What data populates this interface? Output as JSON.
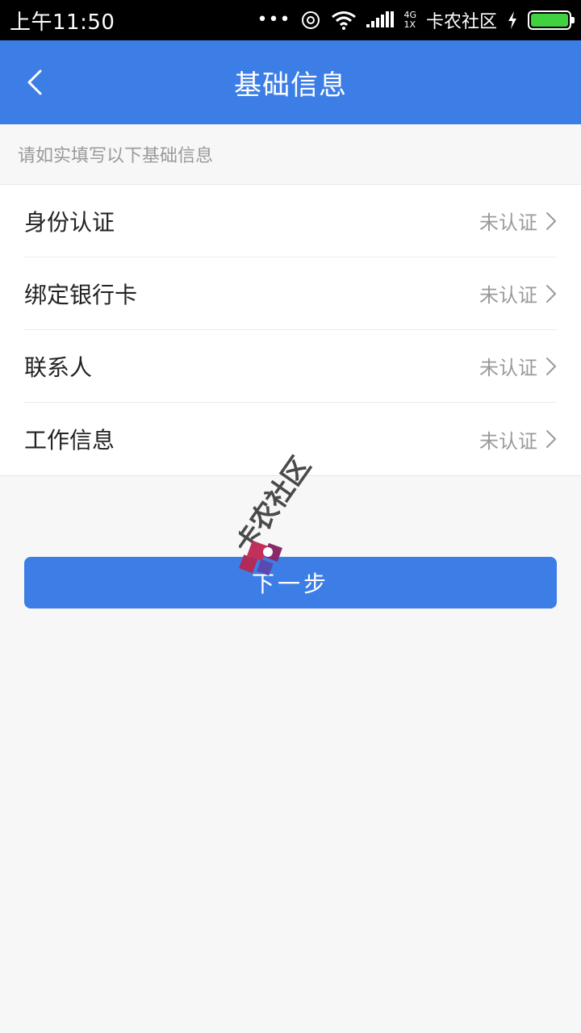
{
  "status_bar": {
    "time": "上午11:50",
    "dots": "•••",
    "network_top": "4G",
    "network_bottom": "1X",
    "carrier": "卡农社区",
    "battery_level": 1.0,
    "battery_color": "#3fd13f"
  },
  "header": {
    "title": "基础信息",
    "back_icon": "chevron-left-icon",
    "color": "#3c7ee6"
  },
  "hint": "请如实填写以下基础信息",
  "items": [
    {
      "label": "身份认证",
      "status": "未认证"
    },
    {
      "label": "绑定银行卡",
      "status": "未认证"
    },
    {
      "label": "联系人",
      "status": "未认证"
    },
    {
      "label": "工作信息",
      "status": "未认证"
    }
  ],
  "next_button": {
    "label": "下一步",
    "color": "#3c7ee6"
  },
  "watermark": {
    "text": "卡农社区"
  }
}
